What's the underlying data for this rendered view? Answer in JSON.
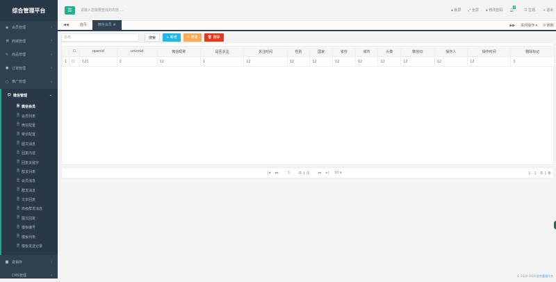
{
  "app": {
    "title": "综合管理平台"
  },
  "sidebar": {
    "items": [
      {
        "label": "会员管理",
        "icon": "user-circle-icon"
      },
      {
        "label": "商城管理",
        "icon": "cart-icon"
      },
      {
        "label": "商品管理",
        "icon": "edit-icon"
      },
      {
        "label": "订单管理",
        "icon": "globe-icon"
      },
      {
        "label": "推广管理",
        "icon": "circle-icon"
      }
    ],
    "open": {
      "label": "微信管理",
      "icon": "wechat-icon",
      "children": [
        "微信会员",
        "会员列表",
        "微信配置",
        "菜单配置",
        "图文消息",
        "回复内容",
        "回复关键字",
        "群发列表",
        "会员消息",
        "群发消息",
        "文本回复",
        "高级群发消息",
        "图文回复",
        "模板编号",
        "模板列表",
        "模板发送记录"
      ]
    },
    "after": [
      {
        "label": "进销存",
        "icon": "chart-icon"
      },
      {
        "label": "CMS管理",
        "icon": ""
      }
    ]
  },
  "header": {
    "search_placeholder": "请输入您需要查找的内容 …",
    "actions": [
      "锁屏",
      "全屏",
      "修改密码",
      "主题",
      "退出"
    ],
    "notification_count": "2"
  },
  "tabs": {
    "items": [
      "首页",
      "微信会员"
    ],
    "close_ops": "关闭操作",
    "refresh": "刷新"
  },
  "toolbar": {
    "search_placeholder": "名称",
    "search": "搜索",
    "add": "+ 新增",
    "edit": "修改",
    "delete": "删除"
  },
  "table": {
    "columns": [
      "openid",
      "unionid",
      "微信昵称",
      "是否关注",
      "关注时间",
      "性别",
      "国家",
      "省份",
      "城市",
      "头像",
      "微信ID",
      "操作人",
      "操作时间",
      "删除标记"
    ],
    "rows": [
      {
        "index": "1",
        "cells": [
          "121",
          "2",
          "12",
          "1",
          "12",
          "12",
          "12",
          "12",
          "12",
          "12",
          "12",
          "12",
          "12",
          "1"
        ]
      }
    ]
  },
  "pager": {
    "page": "1",
    "total_pages": "共 1 页",
    "page_size": "10",
    "summary": "1 - 1　共 1 条"
  },
  "footer": {
    "copyright": "© 2019-2019",
    "link": "综合管理平台"
  },
  "colors": {
    "sidebar": "#2f4050",
    "accent": "#1ab394",
    "add": "#23b7e5",
    "edit": "#f8ac59",
    "delete": "#e23a1e"
  }
}
